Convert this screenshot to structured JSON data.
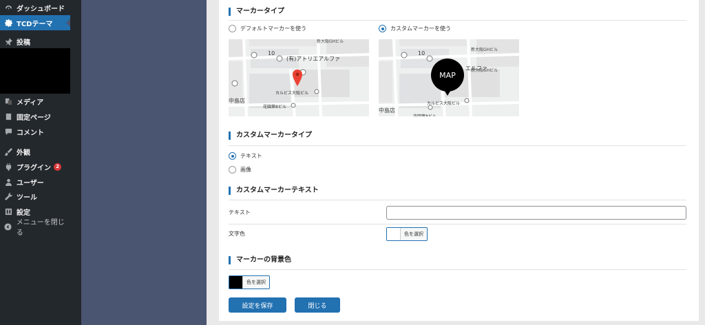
{
  "sidebar": {
    "items": [
      {
        "label": "ダッシュボード",
        "icon": "dashboard-icon"
      },
      {
        "label": "TCDテーマ",
        "icon": "gear-icon"
      },
      {
        "label": "投稿",
        "icon": "pin-icon"
      },
      {
        "label": "メディア",
        "icon": "media-icon"
      },
      {
        "label": "固定ページ",
        "icon": "page-icon"
      },
      {
        "label": "コメント",
        "icon": "comment-icon"
      },
      {
        "label": "外観",
        "icon": "brush-icon"
      },
      {
        "label": "プラグイン",
        "icon": "plugin-icon",
        "badge": "2"
      },
      {
        "label": "ユーザー",
        "icon": "user-icon"
      },
      {
        "label": "ツール",
        "icon": "wrench-icon"
      },
      {
        "label": "設定",
        "icon": "settings-icon"
      },
      {
        "label": "メニューを閉じる",
        "icon": "collapse-icon"
      }
    ],
    "active": "TCDテーマ"
  },
  "marker_type": {
    "title": "マーカータイプ",
    "options": [
      {
        "label": "デフォルトマーカーを使う",
        "selected": false
      },
      {
        "label": "カスタムマーカーを使う",
        "selected": true
      }
    ]
  },
  "map": {
    "labels": {
      "building_top": "新大阪GHビル",
      "atelier": "(有)アトリエアルファ",
      "atelier_short": "エルファ",
      "karubisu": "カルビス大阪ビル",
      "hanazono": "花園第8ビル",
      "nakajima": "中島店",
      "num10": "10",
      "custom_marker": "MAP"
    }
  },
  "custom_marker_type": {
    "title": "カスタムマーカータイプ",
    "options": [
      {
        "label": "テキスト",
        "selected": true
      },
      {
        "label": "画像",
        "selected": false
      }
    ]
  },
  "custom_marker_text": {
    "title": "カスタムマーカーテキスト",
    "text_label": "テキスト",
    "text_value": "",
    "color_label": "文字色",
    "color_button": "色を選択",
    "color_value": "#ffffff"
  },
  "marker_bg": {
    "title": "マーカーの背景色",
    "color_button": "色を選択",
    "color_value": "#000000"
  },
  "actions": {
    "save": "設定を保存",
    "close": "閉じる"
  },
  "colors": {
    "accent": "#2271b1",
    "sidebar_bg": "#23282d",
    "badge": "#d63638",
    "marker_red": "#ea4335"
  }
}
